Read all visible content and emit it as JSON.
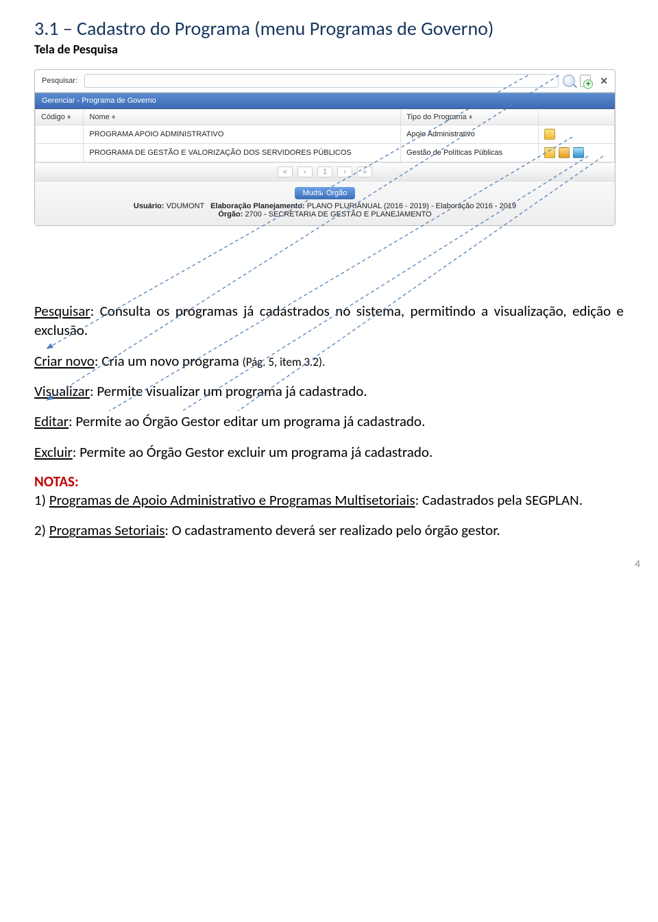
{
  "title": "3.1 – Cadastro do Programa (menu Programas de Governo)",
  "subtitle": "Tela de Pesquisa",
  "search": {
    "label": "Pesquisar:"
  },
  "panel_title": "Gerenciar - Programa de Governo",
  "table": {
    "headers": {
      "codigo": "Código",
      "nome": "Nome",
      "tipo": "Tipo do Programa"
    },
    "rows": [
      {
        "codigo": "",
        "nome": "PROGRAMA APOIO ADMINISTRATIVO",
        "tipo": "Apoio Administrativo",
        "canEdit": false
      },
      {
        "codigo": "",
        "nome": "PROGRAMA DE GESTÃO E VALORIZAÇÃO DOS SERVIDORES PÚBLICOS",
        "tipo": "Gestão de Políticas Públicas",
        "canEdit": true
      }
    ],
    "pager": [
      "«",
      "‹",
      "1",
      "›",
      "»"
    ]
  },
  "footer": {
    "button": "Mudar Órgão",
    "line1_label_user": "Usuário:",
    "line1_user": "VDUMONT",
    "line1_label_plan": "Elaboração Planejamento:",
    "line1_plan": "PLANO PLURIANUAL (2016 - 2019) - Elaboração 2016 - 2019",
    "line2_label": "Órgão:",
    "line2_value": "2700 - SECRETARIA DE GESTÃO E PLANEJAMENTO"
  },
  "desc": {
    "pesquisar_k": "Pesquisar",
    "pesquisar_v": ": Consulta os programas já cadastrados no sistema, permitindo a visualização, edição e exclusão.",
    "criar_k": "Criar novo",
    "criar_v": ":  Cria um novo programa ",
    "criar_ref": "(Pág. 5, item 3.2).",
    "visualizar_k": "Visualizar",
    "visualizar_v": ": Permite visualizar um programa já cadastrado.",
    "editar_k": "Editar",
    "editar_v": ": Permite ao Órgão Gestor editar um programa já cadastrado.",
    "excluir_k": "Excluir",
    "excluir_v": ": Permite ao Órgão Gestor excluir um programa já cadastrado.",
    "notas": "NOTAS:",
    "nota1_k": "Programas de Apoio Administrativo e Programas Multisetoriais",
    "nota1_p": "1) ",
    "nota1_v": ": Cadastrados pela SEGPLAN.",
    "nota2_k": "Programas Setoriais",
    "nota2_p": "2) ",
    "nota2_v": ": O cadastramento deverá ser realizado pelo órgão gestor."
  },
  "page_number": "4"
}
